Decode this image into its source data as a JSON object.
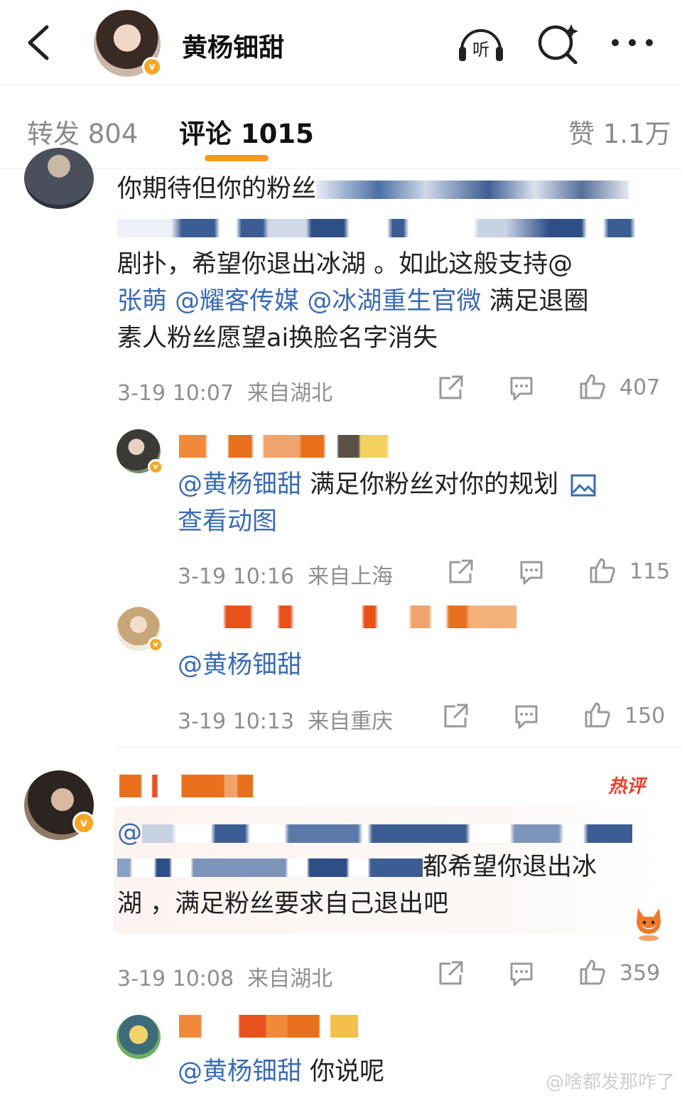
{
  "header": {
    "title": "黄杨钿甜",
    "icons": [
      "back-arrow-icon",
      "listen-icon",
      "search-icon",
      "more-icon"
    ],
    "listen_label": "听"
  },
  "tabs": {
    "repost": "转发 804",
    "comments": "评论 1015",
    "likes": "赞 1.1万"
  },
  "comments": [
    {
      "line1_text": "你期待但你的粉丝",
      "line2_text": "剧扑，希望你退出冰湖 。如此这般支持@",
      "line3_mentions": [
        "张萌",
        "@耀客传媒",
        "@冰湖重生官微"
      ],
      "line3_text": "满足退圈",
      "line4_text": "素人粉丝愿望ai换脸名字消失",
      "time": "3-19 10:07",
      "location": "来自湖北",
      "likes": "407"
    },
    {
      "mention": "@黄杨钿甜",
      "text": "满足你粉丝对你的规划",
      "link": "查看动图",
      "time": "3-19 10:16",
      "location": "来自上海",
      "likes": "115"
    },
    {
      "mention": "@黄杨钿甜",
      "time": "3-19 10:13",
      "location": "来自重庆",
      "likes": "150"
    },
    {
      "badge": "热评",
      "line1_text": "@",
      "line2_text": "都希望你退出冰",
      "line3_text": "湖 ，满足粉丝要求自己退出吧",
      "time": "3-19 10:08",
      "location": "来自湖北",
      "likes": "359"
    },
    {
      "mention": "@黄杨钿甜",
      "text": "你说呢"
    }
  ],
  "watermark": "@啥都发那咋了",
  "colors": {
    "accent": "#f79a1a",
    "mention": "#3a6bb5",
    "hot": "#e8412b",
    "verified": "#f5a623"
  }
}
